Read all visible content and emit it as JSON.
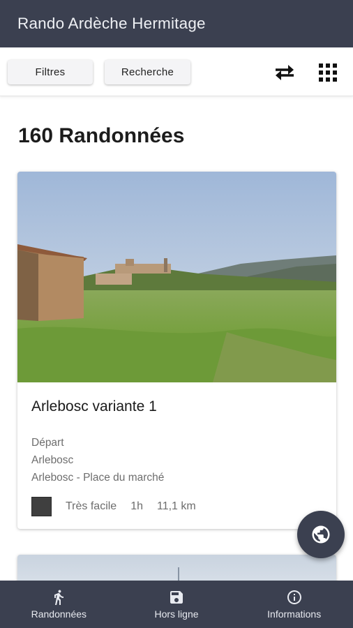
{
  "app": {
    "title": "Rando Ardèche Hermitage"
  },
  "toolbar": {
    "filters_label": "Filtres",
    "search_label": "Recherche",
    "swap_icon": "swap-horiz-icon",
    "grid_icon": "grid-view-icon"
  },
  "list": {
    "count_title": "160 Randonnées"
  },
  "card": {
    "name": "Arlebosc variante 1",
    "departure_label": "Départ",
    "town": "Arlebosc",
    "place": "Arlebosc - Place du marché",
    "difficulty_color": "#3f3f3f",
    "difficulty": "Très facile",
    "duration": "1h",
    "distance": "11,1 km"
  },
  "fab": {
    "icon": "globe-icon"
  },
  "bottom_nav": {
    "items": [
      {
        "label": "Randonnées",
        "icon": "hiker-icon"
      },
      {
        "label": "Hors ligne",
        "icon": "save-icon"
      },
      {
        "label": "Informations",
        "icon": "info-icon"
      }
    ]
  },
  "colors": {
    "primary": "#3b4050",
    "background": "#ffffff"
  }
}
